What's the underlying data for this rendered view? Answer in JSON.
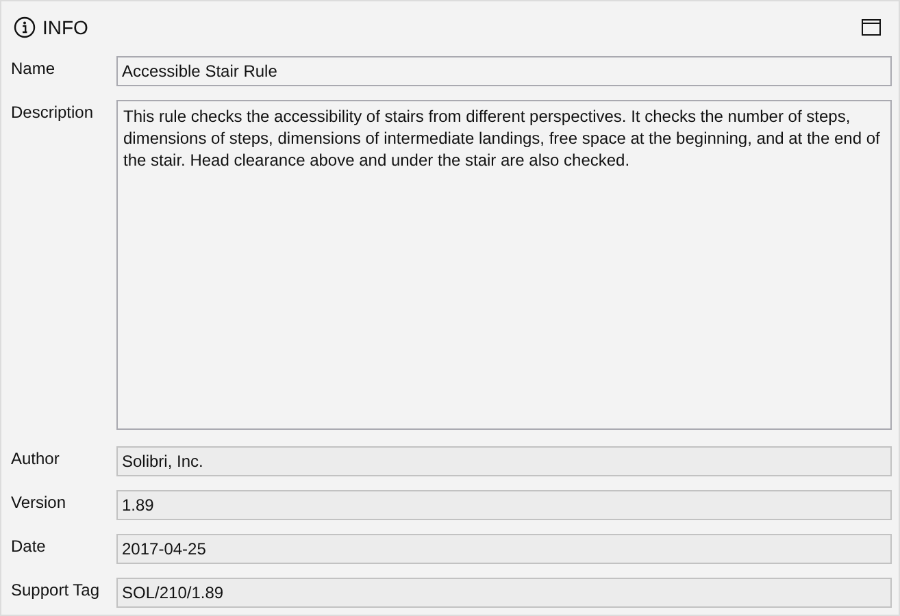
{
  "panel": {
    "title": "INFO"
  },
  "fields": [
    {
      "kind": "line",
      "label": "Name",
      "value": "Accessible Stair Rule",
      "readonly": false
    },
    {
      "kind": "multiline",
      "label": "Description",
      "value": "This rule checks the accessibility of stairs from different perspectives. It checks the number of steps, dimensions of steps, dimensions of intermediate landings, free space at the beginning, and at the end of the stair. Head clearance above and under the stair are also checked.",
      "readonly": false
    },
    {
      "kind": "line",
      "label": "Author",
      "value": "Solibri, Inc.",
      "readonly": true
    },
    {
      "kind": "line",
      "label": "Version",
      "value": "1.89",
      "readonly": true
    },
    {
      "kind": "line",
      "label": "Date",
      "value": "2017-04-25",
      "readonly": true
    },
    {
      "kind": "line",
      "label": "Support Tag",
      "value": "SOL/210/1.89",
      "readonly": true
    }
  ]
}
